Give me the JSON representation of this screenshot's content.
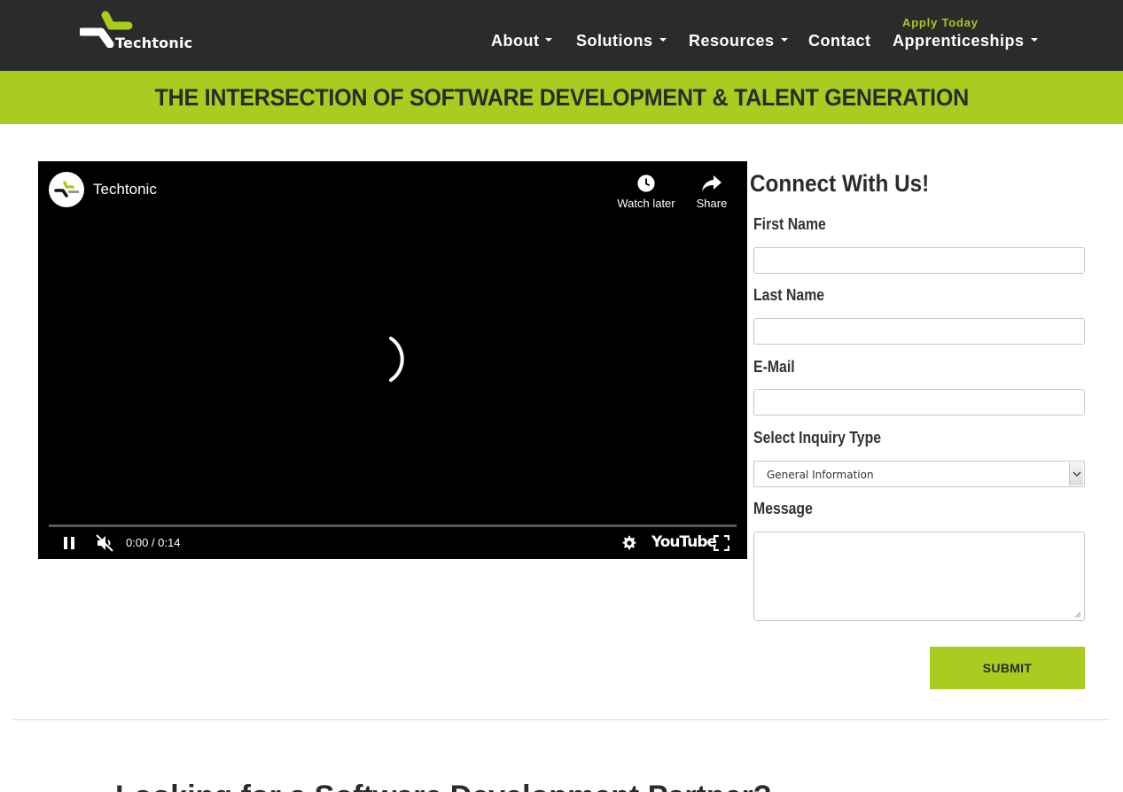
{
  "header": {
    "logo_text": "Techtonic",
    "nav": [
      {
        "label": "About",
        "dropdown": true
      },
      {
        "label": "Solutions",
        "dropdown": true
      },
      {
        "label": "Resources",
        "dropdown": true
      },
      {
        "label": "Contact",
        "dropdown": false
      },
      {
        "label": "Apprenticeships",
        "dropdown": true
      }
    ],
    "apply_today": "Apply Today"
  },
  "banner": {
    "title": "THE INTERSECTION OF SOFTWARE DEVELOPMENT & TALENT GENERATION"
  },
  "video": {
    "channel_name": "Techtonic",
    "watch_later_label": "Watch later",
    "share_label": "Share",
    "time_display": "0:00 / 0:14",
    "wordmark": "YouTube",
    "state": "loading",
    "muted": true
  },
  "form": {
    "title": "Connect With Us!",
    "first_name_label": "First Name",
    "first_name_value": "",
    "last_name_label": "Last Name",
    "last_name_value": "",
    "email_label": "E-Mail",
    "email_value": "",
    "inquiry_label": "Select Inquiry Type",
    "inquiry_selected": "General Information",
    "message_label": "Message",
    "message_value": "",
    "submit_label": "SUBMIT"
  },
  "next_section": {
    "heading_partial": "Looking for a Software Development Partner?"
  },
  "colors": {
    "header_bg": "#2b2b2b",
    "accent_green": "#aacb1f",
    "dark_text": "#2b2b2b"
  },
  "icons": [
    "techtonic-logo",
    "caret-down-icon",
    "clock-icon",
    "share-icon",
    "loading-spinner",
    "pause-icon",
    "muted-icon",
    "settings-icon",
    "fullscreen-icon"
  ]
}
